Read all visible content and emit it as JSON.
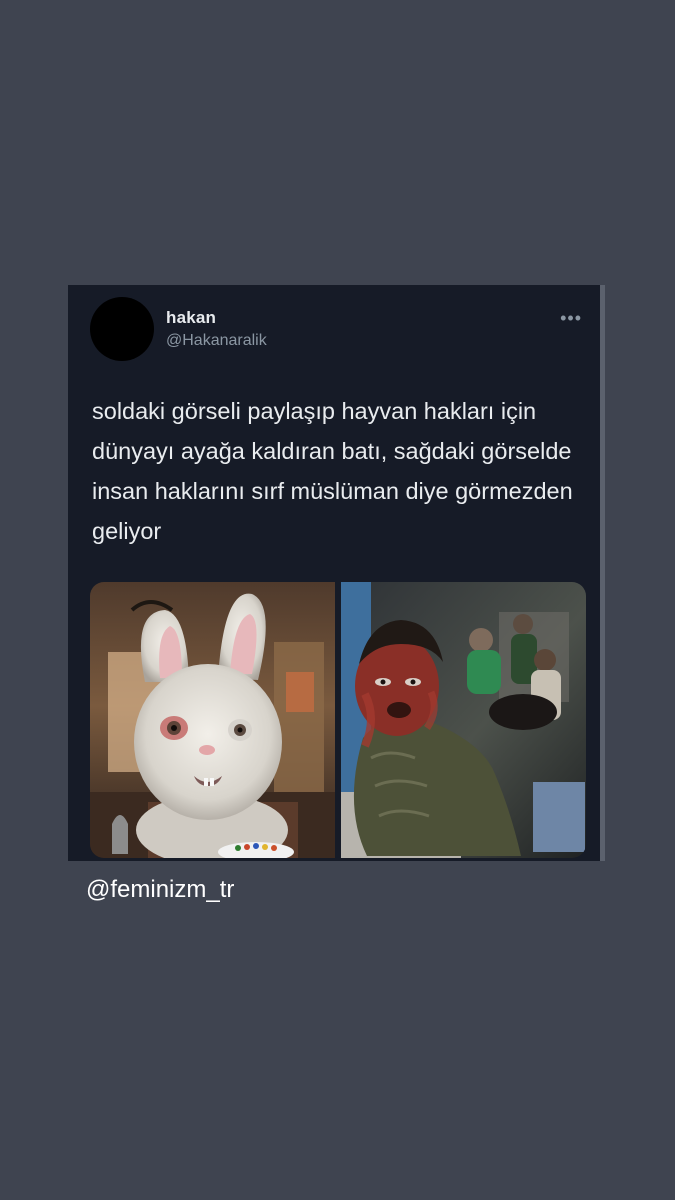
{
  "tweet": {
    "display_name": "hakan",
    "handle": "@Hakanaralik",
    "more_icon": "more-horizontal-icon",
    "text": "soldaki görseli paylaşıp hayvan hakları için dünyayı ayağa kaldıran batı, sağdaki görselde insan haklarını sırf müslüman diye görmezden geliyor",
    "media": [
      "rabbit-puppet-photo",
      "injured-child-photo"
    ]
  },
  "watermark": "@feminizm_tr",
  "colors": {
    "page_background": "#3f4450",
    "card_background": "#161b27",
    "primary_text": "#e9ecef",
    "secondary_text": "#8b97a3"
  }
}
